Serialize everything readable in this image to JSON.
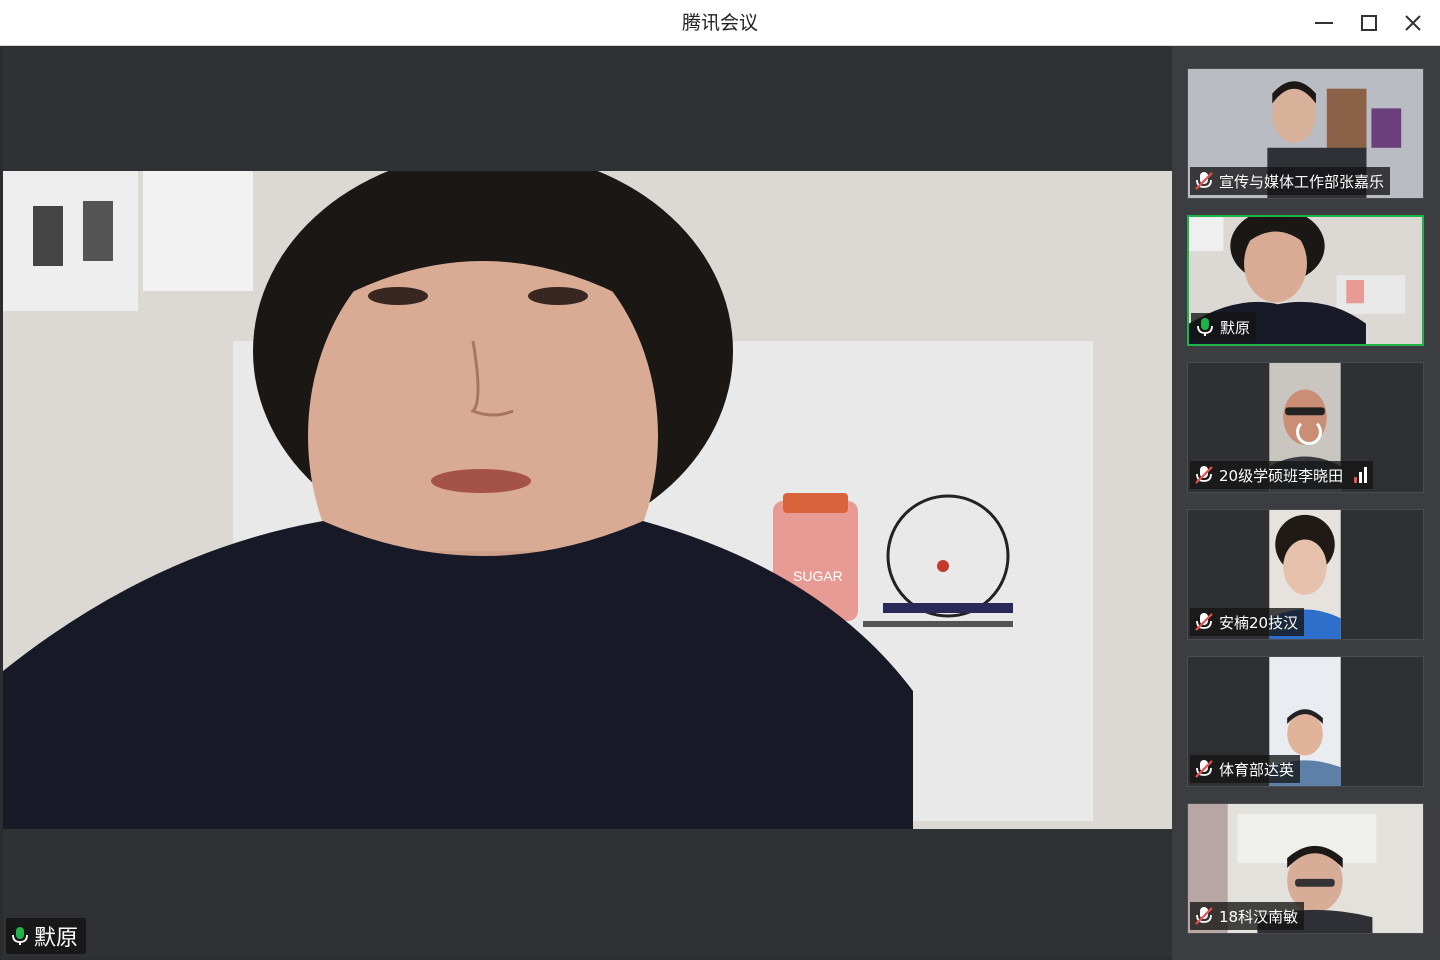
{
  "window": {
    "title": "腾讯会议"
  },
  "main_video": {
    "speaker_name": "默原",
    "mic_state": "speaking",
    "poster_text": "SUGAR"
  },
  "participants": [
    {
      "name": "宣传与媒体工作部张嘉乐",
      "mic": "muted",
      "active": false
    },
    {
      "name": "默原",
      "mic": "speaking",
      "active": true
    },
    {
      "name": "20级学硕班李晓田",
      "mic": "muted",
      "active": false,
      "loading": true,
      "signal": "weak"
    },
    {
      "name": "安楠20技汉",
      "mic": "muted",
      "active": false
    },
    {
      "name": "体育部达英",
      "mic": "muted",
      "active": false
    },
    {
      "name": "18科汉南敏",
      "mic": "muted",
      "active": false
    }
  ],
  "colors": {
    "speaking_green": "#1fb34c",
    "muted_red": "#e85050",
    "rail_bg": "#3b3d41",
    "stage_bg": "#2f3134"
  },
  "icons": [
    "minimize-icon",
    "maximize-icon",
    "close-icon",
    "mic-icon",
    "mic-muted-icon",
    "signal-bars-icon",
    "loading-spinner-icon"
  ]
}
